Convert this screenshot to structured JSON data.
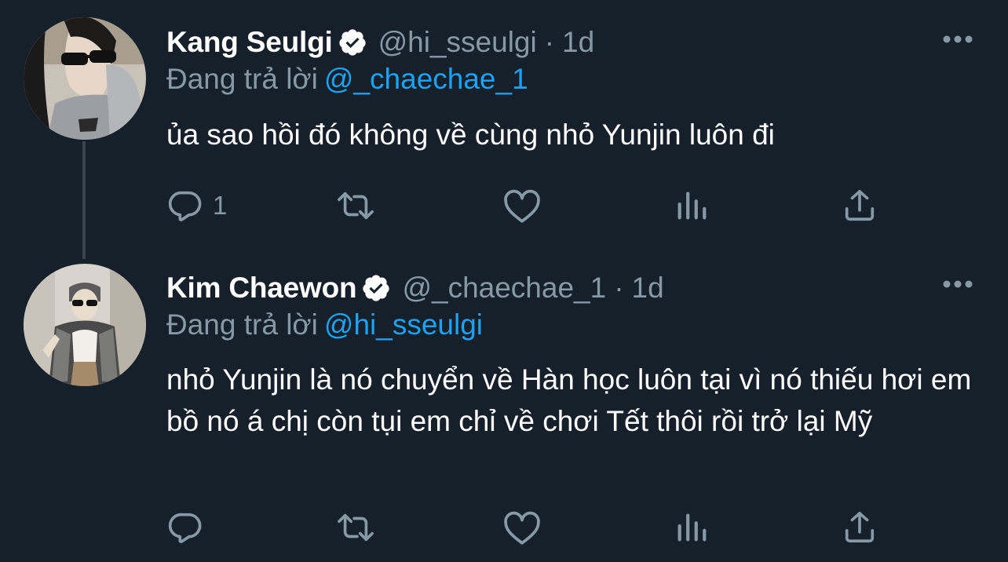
{
  "tweets": [
    {
      "display_name": "Kang Seulgi",
      "verified": true,
      "handle": "@hi_sseulgi",
      "separator": "·",
      "time": "1d",
      "replying_to_prefix": "Đang trả lời",
      "replying_to": "@_chaechae_1",
      "text": "ủa sao hồi đó không về cùng nhỏ Yunjin luôn đi",
      "reply_count": "1",
      "retweet_count": "",
      "like_count": ""
    },
    {
      "display_name": "Kim Chaewon",
      "verified": true,
      "handle": "@_chaechae_1",
      "separator": "·",
      "time": "1d",
      "replying_to_prefix": "Đang trả lời",
      "replying_to": "@hi_sseulgi",
      "text": "nhỏ Yunjin là nó chuyển về Hàn học luôn tại vì nó thiếu hơi em bồ nó á chị còn tụi em chỉ về chơi Tết thôi rồi trở lại Mỹ",
      "reply_count": "",
      "retweet_count": "",
      "like_count": ""
    }
  ],
  "colors": {
    "background": "#15202b",
    "text_primary": "#ffffff",
    "text_secondary": "#8899a6",
    "link": "#1da1f2",
    "thread_line": "#38444d"
  },
  "icons": {
    "reply": "reply-icon",
    "retweet": "retweet-icon",
    "like": "heart-icon",
    "stats": "bar-chart-icon",
    "share": "share-icon",
    "more": "more-dots-icon",
    "verified": "verified-badge-icon"
  }
}
